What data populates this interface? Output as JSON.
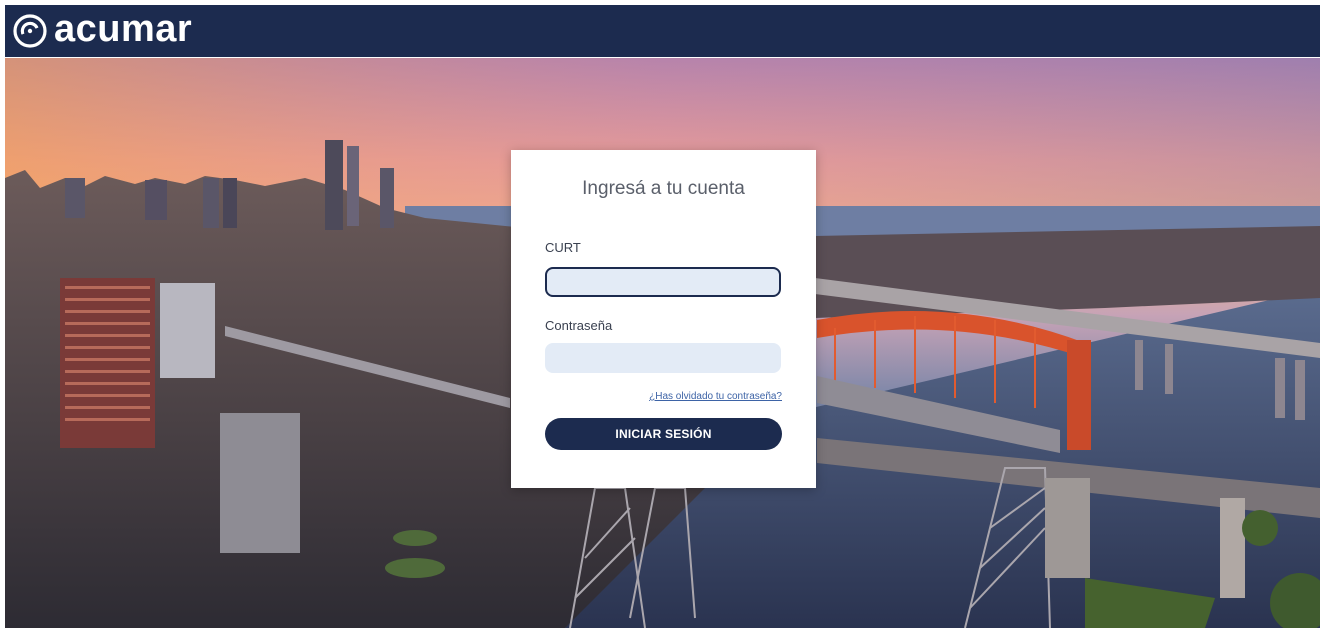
{
  "header": {
    "logo_text": "acumar",
    "logo_icon": "acumar-swirl-logo",
    "background_color": "#1c2b4f"
  },
  "login": {
    "title": "Ingresá a tu cuenta",
    "curt_label": "CURT",
    "curt_value": "",
    "password_label": "Contraseña",
    "password_value": "",
    "forgot_link": "¿Has olvidado tu contraseña?",
    "submit_label": "INICIAR SESIÓN"
  },
  "colors": {
    "brand": "#1c2b4f",
    "input_bg": "#e3ebf6",
    "link": "#3d63a6"
  }
}
